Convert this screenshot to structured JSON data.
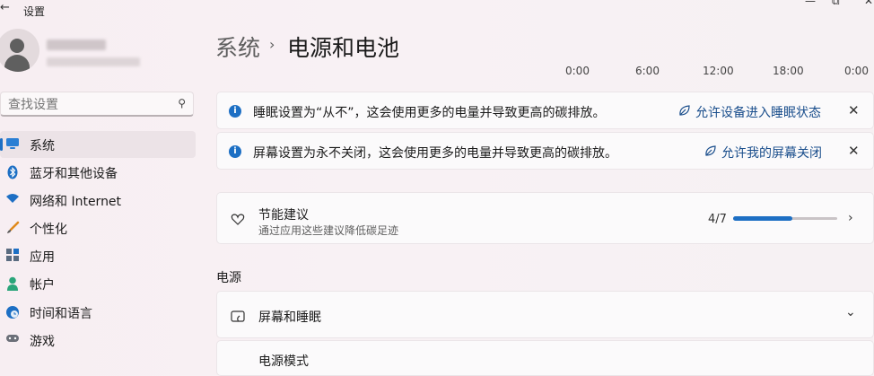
{
  "window": {
    "title": "设置",
    "minimize_glyph": "—",
    "restore_glyph": "⧉",
    "close_glyph": "✕"
  },
  "search": {
    "placeholder": "查找设置"
  },
  "sidebar": {
    "items": [
      {
        "label": "系统",
        "icon": "monitor-icon",
        "active": true
      },
      {
        "label": "蓝牙和其他设备",
        "icon": "bluetooth-icon"
      },
      {
        "label": "网络和 Internet",
        "icon": "wifi-icon"
      },
      {
        "label": "个性化",
        "icon": "brush-icon"
      },
      {
        "label": "应用",
        "icon": "apps-icon"
      },
      {
        "label": "帐户",
        "icon": "person-icon"
      },
      {
        "label": "时间和语言",
        "icon": "globe-clock-icon"
      },
      {
        "label": "游戏",
        "icon": "gamepad-icon"
      }
    ]
  },
  "breadcrumb": {
    "root": "系统",
    "separator": "›",
    "current": "电源和电池"
  },
  "timeline": [
    "0:00",
    "6:00",
    "12:00",
    "18:00",
    "0:00"
  ],
  "notices": [
    {
      "message": "睡眠设置为“从不”，这会使用更多的电量并导致更高的碳排放。",
      "action": "允许设备进入睡眠状态"
    },
    {
      "message": "屏幕设置为永不关闭，这会使用更多的电量并导致更高的碳排放。",
      "action": "允许我的屏幕关闭"
    }
  ],
  "energy": {
    "title": "节能建议",
    "subtitle": "通过应用这些建议降低碳足迹",
    "progress_text": "4/7",
    "progress_fraction": 0.57
  },
  "power": {
    "section_title": "电源",
    "screen_sleep": "屏幕和睡眠",
    "power_mode": "电源模式"
  },
  "colors": {
    "accent": "#1d6fc4",
    "link": "#1a4e8c"
  }
}
